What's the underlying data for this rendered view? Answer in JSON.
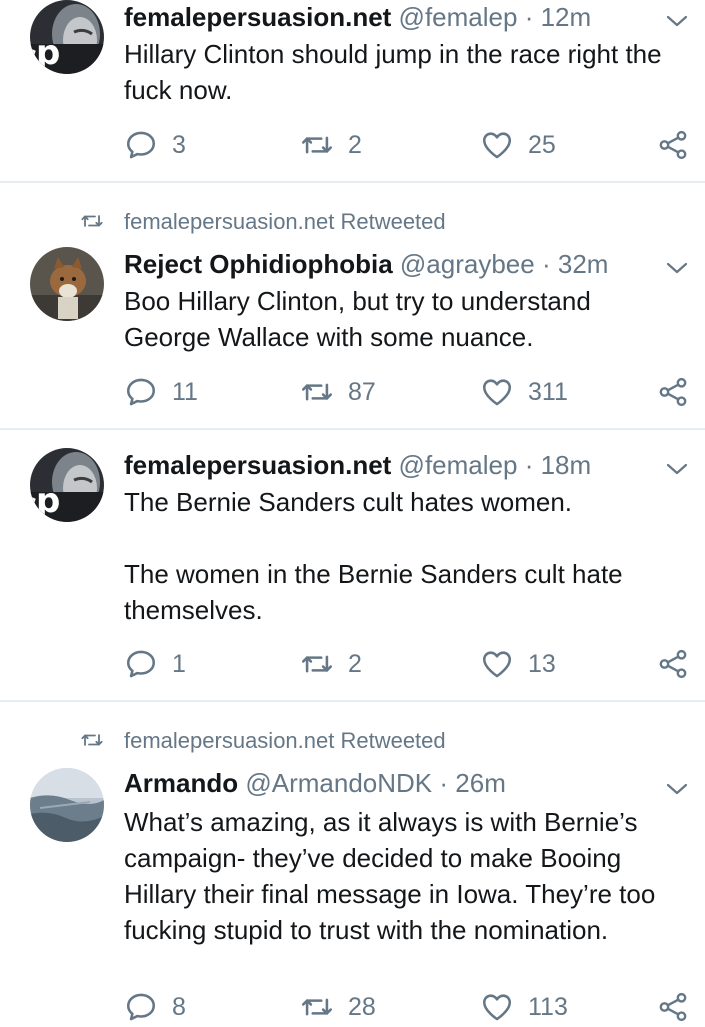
{
  "tweets": [
    {
      "retweeted_by": "",
      "name": "femalepersuasion.net",
      "handle": "@femalep",
      "separator": "·",
      "time": "12m",
      "text": "Hillary Clinton should jump in the race right the fuck now.",
      "replies": "3",
      "retweets": "2",
      "likes": "25"
    },
    {
      "retweeted_by": "femalepersuasion.net Retweeted",
      "name": "Reject Ophidiophobia",
      "handle": "@agraybee",
      "separator": "·",
      "time": "32m",
      "text": "Boo Hillary Clinton, but try to understand George Wallace with some nuance.",
      "replies": "11",
      "retweets": "87",
      "likes": "311"
    },
    {
      "retweeted_by": "",
      "name": "femalepersuasion.net",
      "handle": "@femalep",
      "separator": "·",
      "time": "18m",
      "text_line1": "The Bernie Sanders cult hates women.",
      "text_line2": "The women in the Bernie Sanders cult hate themselves.",
      "replies": "1",
      "retweets": "2",
      "likes": "13"
    },
    {
      "retweeted_by": "femalepersuasion.net Retweeted",
      "name": "Armando",
      "handle": "@ArmandoNDK",
      "separator": "·",
      "time": "26m",
      "text": "What’s amazing, as it always is with Bernie’s campaign- they’ve decided to make Booing Hillary their final message in Iowa. They’re too fucking stupid to trust with the nomination.",
      "replies": "8",
      "retweets": "28",
      "likes": "113"
    }
  ],
  "icons": {
    "reply": "speech-bubble-icon",
    "retweet": "retweet-arrows-icon",
    "like": "heart-icon",
    "share": "share-icon",
    "menu": "chevron-down-icon"
  },
  "colors": {
    "muted": "#657786",
    "text": "#14171a",
    "divider": "#e6ecf0"
  }
}
